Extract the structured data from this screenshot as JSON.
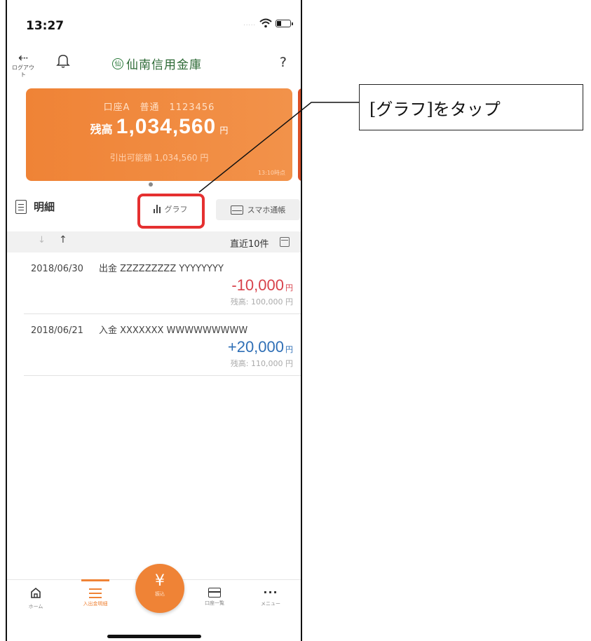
{
  "status_bar": {
    "time": "13:27",
    "signal": "....."
  },
  "header": {
    "logout_label": "ログアウト",
    "brand_name": "仙南信用金庫",
    "brand_mark": "仙",
    "help_label": "?"
  },
  "account_card": {
    "account_line": "口座A　普通　1123456",
    "balance_prefix": "残高",
    "balance_amount": "1,034,560",
    "balance_unit": "円",
    "available_line": "引出可能額 1,034,560 円",
    "as_of": "13:10時点"
  },
  "tabs": {
    "statement_label": "明細",
    "graph_label": "グラフ",
    "passbook_label": "スマホ通帳"
  },
  "sort_bar": {
    "down_arrow": "↓",
    "up_arrow": "↑",
    "recent_label": "直近10件"
  },
  "transactions": [
    {
      "date": "2018/06/30",
      "description": "出金 ZZZZZZZZZ YYYYYYYY",
      "amount": "-10,000",
      "unit": "円",
      "balance": "残高: 100,000 円",
      "color": "#d8424b"
    },
    {
      "date": "2018/06/21",
      "description": "入金 XXXXXXX WWWWWWWWW",
      "amount": "+20,000",
      "unit": "円",
      "balance": "残高: 110,000 円",
      "color": "#2f6fb6"
    }
  ],
  "bottom_nav": {
    "home_label": "ホーム",
    "statement_label": "入出金明細",
    "transfer_label": "振込",
    "transfer_icon": "¥",
    "accounts_label": "口座一覧",
    "menu_label": "メニュー",
    "menu_dots": "···"
  },
  "callout": {
    "text": "[グラフ]をタップ"
  },
  "colors": {
    "accent": "#ef8336",
    "negative": "#d8424b",
    "positive": "#2f6fb6",
    "highlight": "#e53030"
  }
}
